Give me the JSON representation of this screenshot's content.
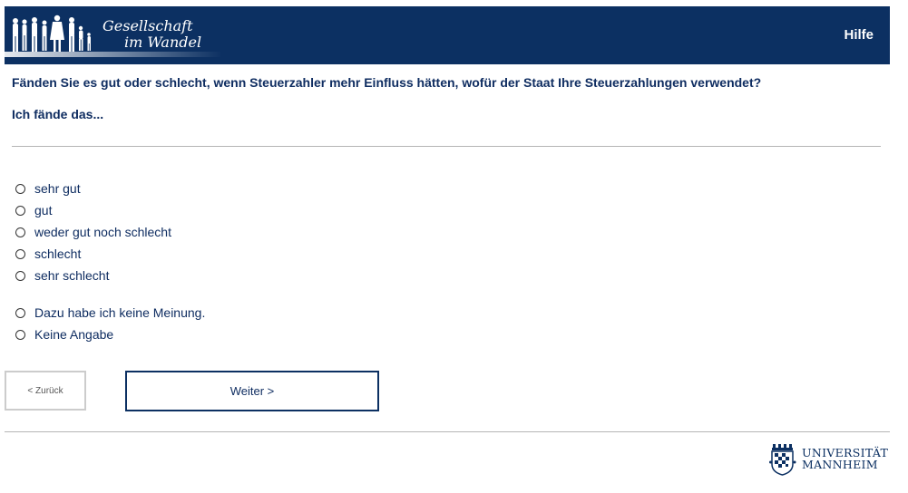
{
  "header": {
    "logo_line1": "Gesellschaft",
    "logo_line2": "im Wandel",
    "help_label": "Hilfe"
  },
  "question": {
    "text": "Fänden Sie es gut oder schlecht, wenn Steuerzahler mehr Einfluss hätten, wofür der Staat Ihre Steuerzahlungen verwendet?",
    "subtext": "Ich fände das..."
  },
  "options": [
    {
      "label": "sehr gut"
    },
    {
      "label": "gut"
    },
    {
      "label": "weder gut noch schlecht"
    },
    {
      "label": "schlecht"
    },
    {
      "label": "sehr schlecht"
    },
    {
      "label": "Dazu habe ich keine Meinung."
    },
    {
      "label": "Keine Angabe"
    }
  ],
  "nav": {
    "back_label": "< Zurück",
    "next_label": "Weiter >"
  },
  "footer": {
    "uni_line1": "UNIVERSITÄT",
    "uni_line2": "MANNHEIM"
  },
  "colors": {
    "brand_blue": "#0c3062",
    "text_blue": "#0f2d61"
  }
}
